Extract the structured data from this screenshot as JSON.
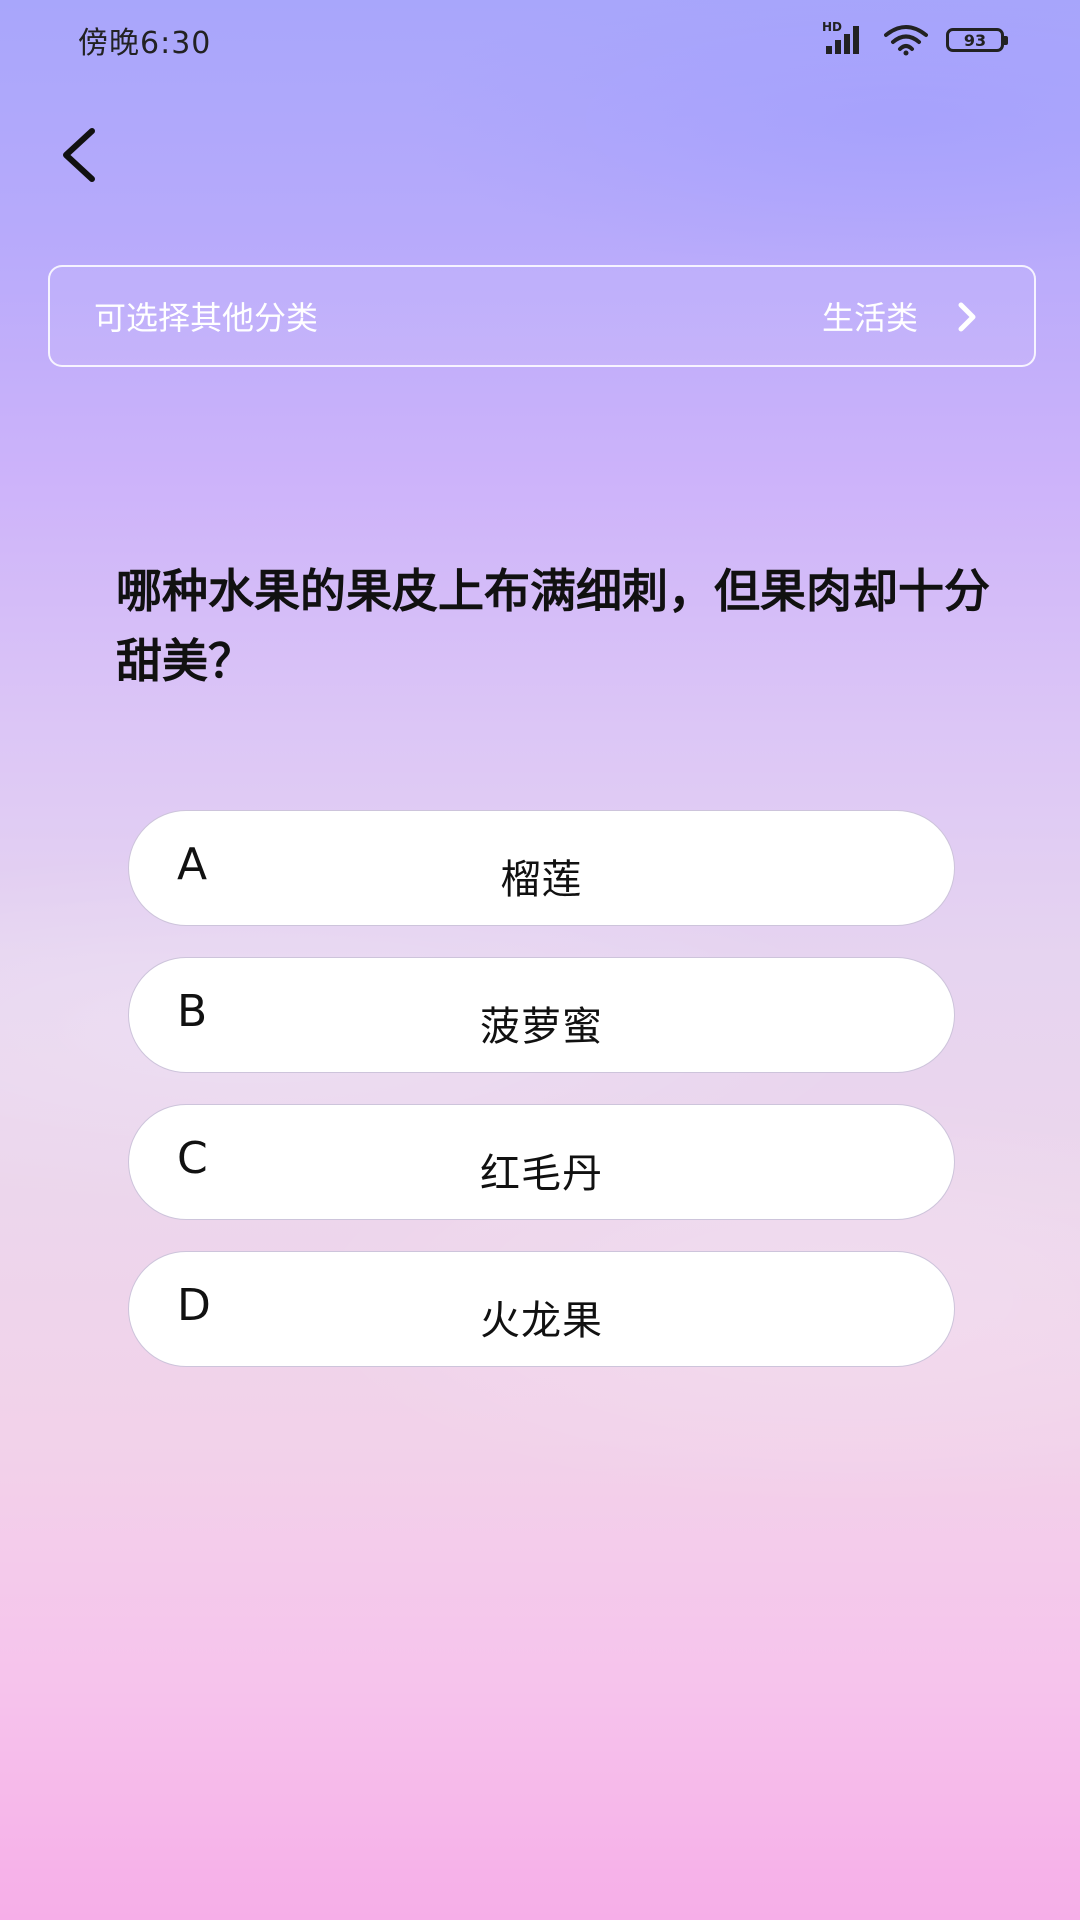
{
  "status_bar": {
    "time": "傍晚6:30",
    "network_label": "HD",
    "battery": "93"
  },
  "category": {
    "hint": "可选择其他分类",
    "current": "生活类"
  },
  "question": {
    "text": "哪种水果的果皮上布满细刺，但果肉却十分甜美？"
  },
  "options": [
    {
      "letter": "A",
      "text": "榴莲"
    },
    {
      "letter": "B",
      "text": "菠萝蜜"
    },
    {
      "letter": "C",
      "text": "红毛丹"
    },
    {
      "letter": "D",
      "text": "火龙果"
    }
  ]
}
